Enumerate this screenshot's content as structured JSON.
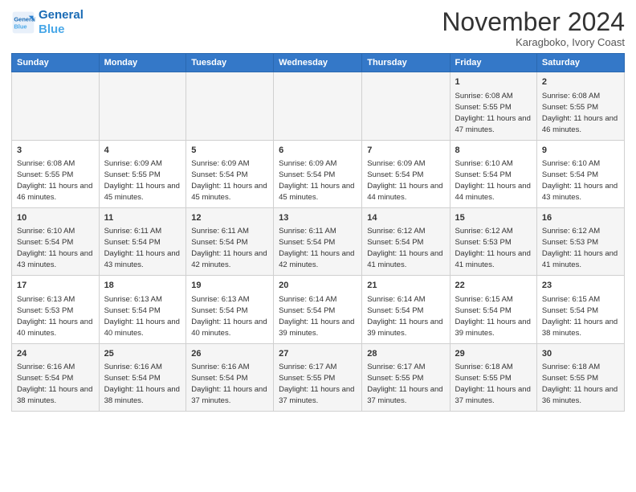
{
  "header": {
    "logo_line1": "General",
    "logo_line2": "Blue",
    "month_title": "November 2024",
    "location": "Karagboko, Ivory Coast"
  },
  "weekdays": [
    "Sunday",
    "Monday",
    "Tuesday",
    "Wednesday",
    "Thursday",
    "Friday",
    "Saturday"
  ],
  "weeks": [
    [
      {
        "day": "",
        "info": ""
      },
      {
        "day": "",
        "info": ""
      },
      {
        "day": "",
        "info": ""
      },
      {
        "day": "",
        "info": ""
      },
      {
        "day": "",
        "info": ""
      },
      {
        "day": "1",
        "info": "Sunrise: 6:08 AM\nSunset: 5:55 PM\nDaylight: 11 hours and 47 minutes."
      },
      {
        "day": "2",
        "info": "Sunrise: 6:08 AM\nSunset: 5:55 PM\nDaylight: 11 hours and 46 minutes."
      }
    ],
    [
      {
        "day": "3",
        "info": "Sunrise: 6:08 AM\nSunset: 5:55 PM\nDaylight: 11 hours and 46 minutes."
      },
      {
        "day": "4",
        "info": "Sunrise: 6:09 AM\nSunset: 5:55 PM\nDaylight: 11 hours and 45 minutes."
      },
      {
        "day": "5",
        "info": "Sunrise: 6:09 AM\nSunset: 5:54 PM\nDaylight: 11 hours and 45 minutes."
      },
      {
        "day": "6",
        "info": "Sunrise: 6:09 AM\nSunset: 5:54 PM\nDaylight: 11 hours and 45 minutes."
      },
      {
        "day": "7",
        "info": "Sunrise: 6:09 AM\nSunset: 5:54 PM\nDaylight: 11 hours and 44 minutes."
      },
      {
        "day": "8",
        "info": "Sunrise: 6:10 AM\nSunset: 5:54 PM\nDaylight: 11 hours and 44 minutes."
      },
      {
        "day": "9",
        "info": "Sunrise: 6:10 AM\nSunset: 5:54 PM\nDaylight: 11 hours and 43 minutes."
      }
    ],
    [
      {
        "day": "10",
        "info": "Sunrise: 6:10 AM\nSunset: 5:54 PM\nDaylight: 11 hours and 43 minutes."
      },
      {
        "day": "11",
        "info": "Sunrise: 6:11 AM\nSunset: 5:54 PM\nDaylight: 11 hours and 43 minutes."
      },
      {
        "day": "12",
        "info": "Sunrise: 6:11 AM\nSunset: 5:54 PM\nDaylight: 11 hours and 42 minutes."
      },
      {
        "day": "13",
        "info": "Sunrise: 6:11 AM\nSunset: 5:54 PM\nDaylight: 11 hours and 42 minutes."
      },
      {
        "day": "14",
        "info": "Sunrise: 6:12 AM\nSunset: 5:54 PM\nDaylight: 11 hours and 41 minutes."
      },
      {
        "day": "15",
        "info": "Sunrise: 6:12 AM\nSunset: 5:53 PM\nDaylight: 11 hours and 41 minutes."
      },
      {
        "day": "16",
        "info": "Sunrise: 6:12 AM\nSunset: 5:53 PM\nDaylight: 11 hours and 41 minutes."
      }
    ],
    [
      {
        "day": "17",
        "info": "Sunrise: 6:13 AM\nSunset: 5:53 PM\nDaylight: 11 hours and 40 minutes."
      },
      {
        "day": "18",
        "info": "Sunrise: 6:13 AM\nSunset: 5:54 PM\nDaylight: 11 hours and 40 minutes."
      },
      {
        "day": "19",
        "info": "Sunrise: 6:13 AM\nSunset: 5:54 PM\nDaylight: 11 hours and 40 minutes."
      },
      {
        "day": "20",
        "info": "Sunrise: 6:14 AM\nSunset: 5:54 PM\nDaylight: 11 hours and 39 minutes."
      },
      {
        "day": "21",
        "info": "Sunrise: 6:14 AM\nSunset: 5:54 PM\nDaylight: 11 hours and 39 minutes."
      },
      {
        "day": "22",
        "info": "Sunrise: 6:15 AM\nSunset: 5:54 PM\nDaylight: 11 hours and 39 minutes."
      },
      {
        "day": "23",
        "info": "Sunrise: 6:15 AM\nSunset: 5:54 PM\nDaylight: 11 hours and 38 minutes."
      }
    ],
    [
      {
        "day": "24",
        "info": "Sunrise: 6:16 AM\nSunset: 5:54 PM\nDaylight: 11 hours and 38 minutes."
      },
      {
        "day": "25",
        "info": "Sunrise: 6:16 AM\nSunset: 5:54 PM\nDaylight: 11 hours and 38 minutes."
      },
      {
        "day": "26",
        "info": "Sunrise: 6:16 AM\nSunset: 5:54 PM\nDaylight: 11 hours and 37 minutes."
      },
      {
        "day": "27",
        "info": "Sunrise: 6:17 AM\nSunset: 5:55 PM\nDaylight: 11 hours and 37 minutes."
      },
      {
        "day": "28",
        "info": "Sunrise: 6:17 AM\nSunset: 5:55 PM\nDaylight: 11 hours and 37 minutes."
      },
      {
        "day": "29",
        "info": "Sunrise: 6:18 AM\nSunset: 5:55 PM\nDaylight: 11 hours and 37 minutes."
      },
      {
        "day": "30",
        "info": "Sunrise: 6:18 AM\nSunset: 5:55 PM\nDaylight: 11 hours and 36 minutes."
      }
    ]
  ]
}
